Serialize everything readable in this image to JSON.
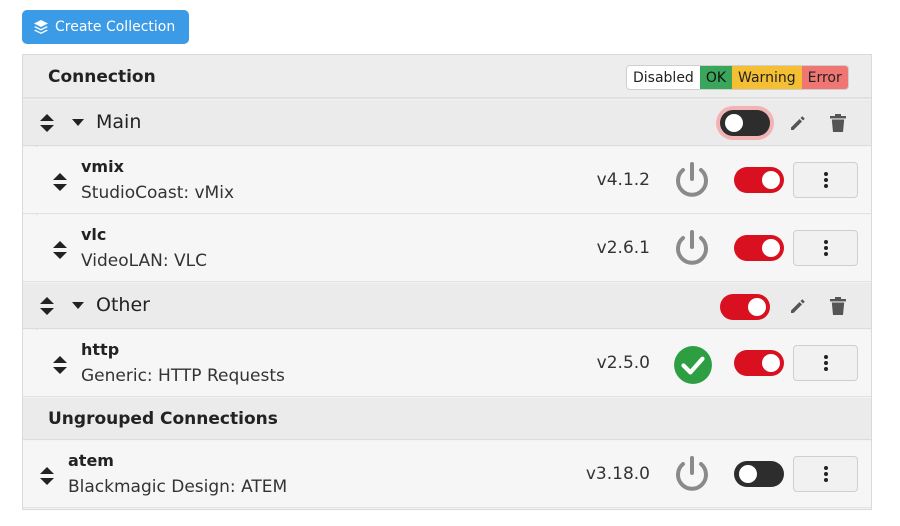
{
  "toolbar": {
    "create_label": "Create Collection"
  },
  "panel": {
    "title": "Connection",
    "legend": {
      "disabled": "Disabled",
      "ok": "OK",
      "warning": "Warning",
      "error": "Error"
    }
  },
  "groups": [
    {
      "name": "Main",
      "enabled": false,
      "connections": [
        {
          "name": "vmix",
          "description": "StudioCoast: vMix",
          "version": "v4.1.2",
          "status": "disabled",
          "enabled": true
        },
        {
          "name": "vlc",
          "description": "VideoLAN: VLC",
          "version": "v2.6.1",
          "status": "disabled",
          "enabled": true
        }
      ]
    },
    {
      "name": "Other",
      "enabled": true,
      "connections": [
        {
          "name": "http",
          "description": "Generic: HTTP Requests",
          "version": "v2.5.0",
          "status": "ok",
          "enabled": true
        }
      ]
    }
  ],
  "ungrouped": {
    "title": "Ungrouped Connections",
    "connections": [
      {
        "name": "atem",
        "description": "Blackmagic Design: ATEM",
        "version": "v3.18.0",
        "status": "disabled",
        "enabled": false
      }
    ]
  },
  "colors": {
    "accent": "#3c9be6",
    "toggle_on": "#d9101f",
    "toggle_off": "#2d2d2d",
    "ok": "#2e9e43",
    "power": "#8a8a8a"
  },
  "icons": {
    "create": "layers-icon",
    "sort": "sort-icon",
    "caret": "caret-down-icon",
    "edit": "pencil-icon",
    "delete": "trash-icon",
    "menu": "more-vertical-icon",
    "power": "power-icon",
    "ok": "check-circle-icon"
  }
}
